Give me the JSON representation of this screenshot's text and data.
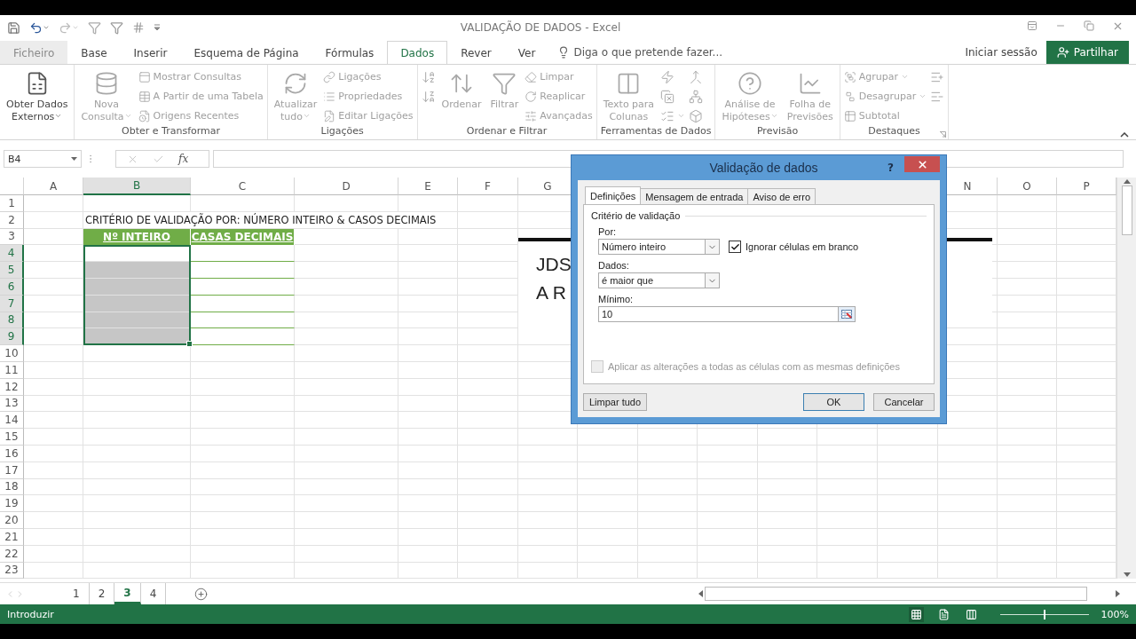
{
  "window": {
    "title": "VALIDAÇÃO DE DADOS - Excel"
  },
  "ribbon_tabs": [
    {
      "label": "Ficheiro",
      "selected": false,
      "disabled": true
    },
    {
      "label": "Base",
      "selected": false,
      "disabled": false
    },
    {
      "label": "Inserir",
      "selected": false,
      "disabled": false
    },
    {
      "label": "Esquema de Página",
      "selected": false,
      "disabled": false
    },
    {
      "label": "Fórmulas",
      "selected": false,
      "disabled": false
    },
    {
      "label": "Dados",
      "selected": true,
      "disabled": false
    },
    {
      "label": "Rever",
      "selected": false,
      "disabled": false
    },
    {
      "label": "Ver",
      "selected": false,
      "disabled": false
    }
  ],
  "tell_me": {
    "placeholder": "Diga o que pretende fazer..."
  },
  "account": {
    "sign_in": "Iniciar sessão",
    "share": "Partilhar"
  },
  "ribbon_groups": [
    {
      "columns": [
        {
          "kind": "large",
          "lines": [
            "Obter Dados",
            "Externos"
          ],
          "dropdown": true,
          "disabled": false
        }
      ]
    },
    {
      "label": "Obter e Transformar",
      "columns": [
        {
          "kind": "large",
          "lines": [
            "Nova",
            "Consulta"
          ],
          "dropdown": true,
          "disabled": true
        },
        {
          "kind": "stack",
          "items": [
            {
              "label": "Mostrar Consultas",
              "dropdown": false,
              "disabled": true
            },
            {
              "label": "A Partir de uma Tabela",
              "dropdown": false,
              "disabled": true
            },
            {
              "label": "Origens Recentes",
              "dropdown": false,
              "disabled": true
            }
          ]
        }
      ]
    },
    {
      "label": "Ligações",
      "columns": [
        {
          "kind": "large",
          "lines": [
            "Atualizar",
            "tudo"
          ],
          "dropdown": true,
          "disabled": true
        },
        {
          "kind": "stack",
          "items": [
            {
              "label": "Ligações",
              "dropdown": false,
              "disabled": true
            },
            {
              "label": "Propriedades",
              "dropdown": false,
              "disabled": true
            },
            {
              "label": "Editar Ligações",
              "dropdown": false,
              "disabled": true
            }
          ]
        }
      ]
    },
    {
      "label": "Ordenar e Filtrar",
      "columns": [
        {
          "kind": "icons",
          "items": [
            {
              "dropdown": false,
              "disabled": true
            },
            {
              "dropdown": false,
              "disabled": true
            }
          ]
        },
        {
          "kind": "large",
          "lines": [
            "Ordenar"
          ],
          "dropdown": false,
          "disabled": true
        },
        {
          "kind": "large",
          "lines": [
            "Filtrar"
          ],
          "dropdown": false,
          "disabled": true
        },
        {
          "kind": "stack",
          "items": [
            {
              "label": "Limpar",
              "dropdown": false,
              "disabled": true
            },
            {
              "label": "Reaplicar",
              "dropdown": false,
              "disabled": true
            },
            {
              "label": "Avançadas",
              "dropdown": false,
              "disabled": true
            }
          ]
        }
      ]
    },
    {
      "label": "Ferramentas de Dados",
      "columns": [
        {
          "kind": "large",
          "lines": [
            "Texto para",
            "Colunas"
          ],
          "dropdown": false,
          "disabled": true
        },
        {
          "kind": "icons",
          "items": [
            {
              "dropdown": false,
              "disabled": true
            },
            {
              "dropdown": false,
              "disabled": true
            },
            {
              "dropdown": true,
              "disabled": true
            }
          ]
        },
        {
          "kind": "icons",
          "items": [
            {
              "dropdown": false,
              "disabled": true
            },
            {
              "dropdown": false,
              "disabled": true
            },
            {
              "dropdown": false,
              "disabled": true
            }
          ]
        }
      ]
    },
    {
      "label": "Previsão",
      "columns": [
        {
          "kind": "large",
          "lines": [
            "Análise de",
            "Hipóteses"
          ],
          "dropdown": true,
          "disabled": true
        },
        {
          "kind": "large",
          "lines": [
            "Folha de",
            "Previsões"
          ],
          "dropdown": false,
          "disabled": true
        }
      ]
    },
    {
      "label": "Destaques",
      "launcher": true,
      "columns": [
        {
          "kind": "stack",
          "items": [
            {
              "label": "Agrupar",
              "dropdown": true,
              "disabled": true
            },
            {
              "label": "Desagrupar",
              "dropdown": true,
              "disabled": true
            },
            {
              "label": "Subtotal",
              "dropdown": false,
              "disabled": true
            }
          ]
        },
        {
          "kind": "icons",
          "items": [
            {
              "dropdown": false,
              "disabled": true
            },
            {
              "dropdown": false,
              "disabled": true
            }
          ]
        }
      ]
    }
  ],
  "formula_bar": {
    "name_box": "B4",
    "function_label": "fx"
  },
  "sheet": {
    "columns_left": [
      {
        "label": "A",
        "selected": false
      },
      {
        "label": "B",
        "selected": true
      },
      {
        "label": "C",
        "selected": false
      },
      {
        "label": "D",
        "selected": false
      },
      {
        "label": "E",
        "selected": false
      },
      {
        "label": "F",
        "selected": false
      },
      {
        "label": "G",
        "selected": false
      }
    ],
    "columns_right": [
      {
        "label": "N",
        "selected": false
      },
      {
        "label": "O",
        "selected": false
      },
      {
        "label": "P",
        "selected": false
      }
    ],
    "rows": [
      {
        "label": "1",
        "selected": false
      },
      {
        "label": "2",
        "selected": false
      },
      {
        "label": "3",
        "selected": false
      },
      {
        "label": "4",
        "selected": true
      },
      {
        "label": "5",
        "selected": true
      },
      {
        "label": "6",
        "selected": true
      },
      {
        "label": "7",
        "selected": true
      },
      {
        "label": "8",
        "selected": true
      },
      {
        "label": "9",
        "selected": true
      },
      {
        "label": "10",
        "selected": false
      },
      {
        "label": "11",
        "selected": false
      },
      {
        "label": "12",
        "selected": false
      },
      {
        "label": "13",
        "selected": false
      },
      {
        "label": "14",
        "selected": false
      },
      {
        "label": "15",
        "selected": false
      },
      {
        "label": "16",
        "selected": false
      },
      {
        "label": "17",
        "selected": false
      },
      {
        "label": "18",
        "selected": false
      },
      {
        "label": "19",
        "selected": false
      },
      {
        "label": "20",
        "selected": false
      },
      {
        "label": "21",
        "selected": false
      },
      {
        "label": "22",
        "selected": false
      },
      {
        "label": "23",
        "selected": false
      }
    ],
    "title_cell": "CRITÉRIO DE VALIDAÇÃO POR: NÚMERO INTEIRO & CASOS DECIMAIS",
    "header_cells": [
      "Nº INTEIRO",
      "CASAS DECIMAIS"
    ],
    "text_box": {
      "lines": [
        "JDS",
        "A R"
      ]
    }
  },
  "dialog": {
    "title": "Validação de dados",
    "help": "?",
    "tabs": [
      {
        "label": "Definições",
        "selected": true
      },
      {
        "label": "Mensagem de entrada",
        "selected": false
      },
      {
        "label": "Aviso de erro",
        "selected": false
      }
    ],
    "section": "Critério de validação",
    "fields": [
      {
        "kind": "select",
        "label": "Por:",
        "value": "Número inteiro"
      },
      {
        "kind": "select",
        "label": "Dados:",
        "value": "é maior que"
      },
      {
        "kind": "range",
        "label": "Mínimo:",
        "value": "10"
      }
    ],
    "ignore_blank": {
      "label": "Ignorar células em branco",
      "checked": true,
      "disabled": false
    },
    "apply_all": {
      "label": "Aplicar as alterações a todas as células com as mesmas definições",
      "checked": false,
      "disabled": true
    },
    "buttons": [
      {
        "label": "Limpar tudo",
        "kind": "left",
        "default": false
      },
      {
        "label": "OK",
        "kind": "right",
        "default": true
      },
      {
        "label": "Cancelar",
        "kind": "right",
        "default": false
      }
    ]
  },
  "sheet_tabs": [
    {
      "label": "1",
      "selected": false
    },
    {
      "label": "2",
      "selected": false
    },
    {
      "label": "3",
      "selected": true
    },
    {
      "label": "4",
      "selected": false
    }
  ],
  "status_bar": {
    "mode": "Introduzir",
    "views": [
      {
        "selected": true
      },
      {
        "selected": false
      },
      {
        "selected": false
      }
    ],
    "zoom": {
      "level": 0.5,
      "reading": "100%"
    }
  }
}
